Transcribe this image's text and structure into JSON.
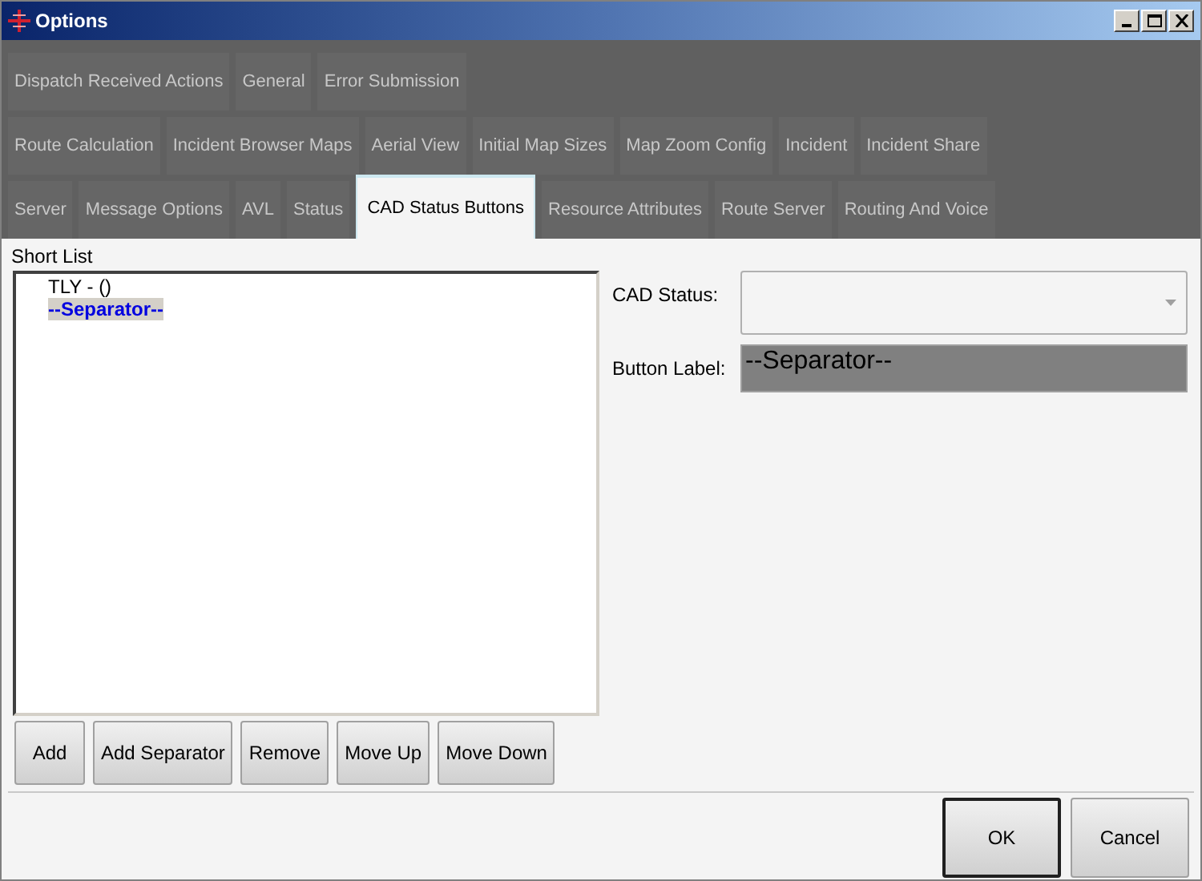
{
  "window": {
    "title": "Options"
  },
  "tab_rows": [
    [
      {
        "label": "Dispatch Received Actions",
        "selected": false
      },
      {
        "label": "General",
        "selected": false
      },
      {
        "label": "Error Submission",
        "selected": false
      }
    ],
    [
      {
        "label": "Route Calculation",
        "selected": false
      },
      {
        "label": "Incident Browser Maps",
        "selected": false
      },
      {
        "label": "Aerial View",
        "selected": false
      },
      {
        "label": "Initial Map Sizes",
        "selected": false
      },
      {
        "label": "Map Zoom Config",
        "selected": false
      },
      {
        "label": "Incident",
        "selected": false
      },
      {
        "label": "Incident Share",
        "selected": false
      }
    ],
    [
      {
        "label": "Server",
        "selected": false
      },
      {
        "label": "Message Options",
        "selected": false
      },
      {
        "label": "AVL",
        "selected": false
      },
      {
        "label": "Status",
        "selected": false
      },
      {
        "label": "CAD Status Buttons",
        "selected": true
      },
      {
        "label": "Resource Attributes",
        "selected": false
      },
      {
        "label": "Route Server",
        "selected": false
      },
      {
        "label": "Routing And Voice",
        "selected": false
      }
    ]
  ],
  "short_list": {
    "label": "Short List",
    "items": [
      {
        "text": "TLY - ()",
        "selected": false
      },
      {
        "text": "--Separator--",
        "selected": true
      }
    ]
  },
  "list_buttons": [
    "Add",
    "Add Separator",
    "Remove",
    "Move Up",
    "Move Down"
  ],
  "cad_status": {
    "label": "CAD Status:"
  },
  "button_label": {
    "label": "Button Label:",
    "value": "--Separator--"
  },
  "dialog_buttons": [
    {
      "label": "OK",
      "default": true
    },
    {
      "label": "Cancel",
      "default": false
    }
  ]
}
